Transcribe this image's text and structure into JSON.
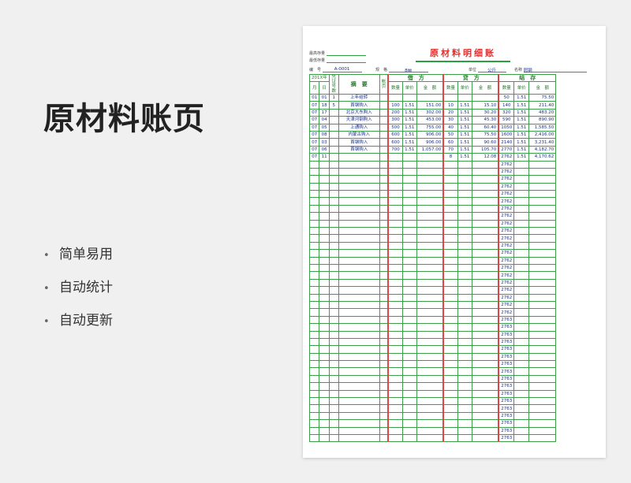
{
  "promo": {
    "title": "原材料账页",
    "features": [
      "简单易用",
      "自动统计",
      "自动更新"
    ]
  },
  "ledger": {
    "title": "原材料明细账",
    "max_stock_label": "最高存量",
    "min_stock_label": "最低存量",
    "code_label": "编　号",
    "code_value": "A-0001",
    "spec_label": "规　格",
    "spec_value": "8㎜",
    "unit_label": "单位",
    "unit_value": "公斤",
    "name_label": "名称",
    "name_value": "园钢",
    "headers": {
      "year": "201X年",
      "month": "月",
      "day": "日",
      "voucher": "凭证号数",
      "summary": "摘　要",
      "page": "帐页",
      "debit": "借　方",
      "credit": "贷　方",
      "balance": "结　存",
      "qty": "数量",
      "price": "单价",
      "amount": "金　额"
    },
    "rows": [
      {
        "m": "01",
        "d": "01",
        "v": "1",
        "desc": "上年结转",
        "dq": "",
        "dp": "",
        "da": "",
        "cq": "",
        "cp": "",
        "ca": "",
        "bq": "50",
        "bp": "1.51",
        "ba": "75.50"
      },
      {
        "m": "07",
        "d": "18",
        "v": "5",
        "desc": "首钢购入",
        "dq": "100",
        "dp": "1.51",
        "da": "151.00",
        "cq": "10",
        "cp": "1.51",
        "ca": "15.10",
        "bq": "140",
        "bp": "1.51",
        "ba": "211.40"
      },
      {
        "m": "07",
        "d": "17",
        "v": "",
        "desc": "北京大东购入",
        "dq": "200",
        "dp": "1.51",
        "da": "302.00",
        "cq": "20",
        "cp": "1.51",
        "ca": "30.20",
        "bq": "320",
        "bp": "1.51",
        "ba": "483.20"
      },
      {
        "m": "07",
        "d": "04",
        "v": "",
        "desc": "天津河钢购入",
        "dq": "300",
        "dp": "1.51",
        "da": "453.00",
        "cq": "30",
        "cp": "1.51",
        "ca": "45.30",
        "bq": "590",
        "bp": "1.51",
        "ba": "890.90"
      },
      {
        "m": "07",
        "d": "05",
        "v": "",
        "desc": "上通购入",
        "dq": "500",
        "dp": "1.51",
        "da": "755.00",
        "cq": "40",
        "cp": "1.51",
        "ca": "60.40",
        "bq": "1050",
        "bp": "1.51",
        "ba": "1,585.50"
      },
      {
        "m": "07",
        "d": "08",
        "v": "",
        "desc": "内蒙古购入",
        "dq": "600",
        "dp": "1.51",
        "da": "906.00",
        "cq": "50",
        "cp": "1.51",
        "ca": "75.50",
        "bq": "1600",
        "bp": "1.51",
        "ba": "2,416.00"
      },
      {
        "m": "07",
        "d": "03",
        "v": "",
        "desc": "首钢购入",
        "dq": "600",
        "dp": "1.51",
        "da": "906.00",
        "cq": "60",
        "cp": "1.51",
        "ca": "90.60",
        "bq": "2140",
        "bp": "1.51",
        "ba": "3,231.40"
      },
      {
        "m": "07",
        "d": "06",
        "v": "",
        "desc": "首钢购入",
        "dq": "700",
        "dp": "1.51",
        "da": "1,057.00",
        "cq": "70",
        "cp": "1.51",
        "ca": "105.70",
        "bq": "2770",
        "bp": "1.51",
        "ba": "4,182.70"
      },
      {
        "m": "07",
        "d": "11",
        "v": "",
        "desc": "",
        "dq": "",
        "dp": "",
        "da": "",
        "cq": "8",
        "cp": "1.51",
        "ca": "12.08",
        "bq": "2762",
        "bp": "1.51",
        "ba": "4,170.62"
      }
    ],
    "carry_values": [
      "2762",
      "2762",
      "2762",
      "2762",
      "2762",
      "2762",
      "2762",
      "2762",
      "2762",
      "2762",
      "2762",
      "2762",
      "2762",
      "2762",
      "2762",
      "2762",
      "2762",
      "2762",
      "2762",
      "2762",
      "2762",
      "2763",
      "2763",
      "2763",
      "2763",
      "2763",
      "2763",
      "2763",
      "2763",
      "2763",
      "2763",
      "2763",
      "2763",
      "2763",
      "2763",
      "2763",
      "2763",
      "2763"
    ]
  }
}
